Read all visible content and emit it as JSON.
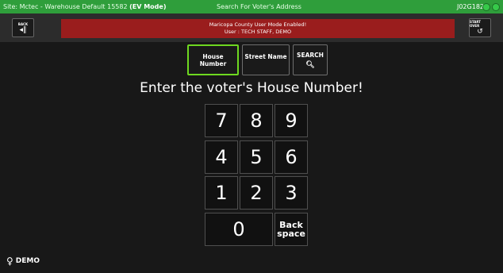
{
  "topbar": {
    "site_prefix": "Site: Mctec - Warehouse Default 15582 ",
    "site_mode": "(EV Mode)",
    "center_title": "Search For Voter's Address",
    "device_id": "J02G182"
  },
  "header": {
    "back_label": "BACK",
    "start_over_label": "START OVER",
    "banner_line1": "Maricopa County User Mode Enabled!",
    "banner_line2": "User : TECH STAFF, DEMO"
  },
  "search_modes": {
    "house_number": "House Number",
    "street_name": "Street Name",
    "search": "SEARCH"
  },
  "prompt": "Enter the voter's House Number!",
  "keypad": {
    "k7": "7",
    "k8": "8",
    "k9": "9",
    "k4": "4",
    "k5": "5",
    "k6": "6",
    "k1": "1",
    "k2": "2",
    "k3": "3",
    "k0": "0",
    "backspace_line1": "Back",
    "backspace_line2": "space"
  },
  "footer": {
    "label": "DEMO"
  },
  "colors": {
    "topbar_green": "#2f9e3b",
    "banner_red": "#9a1d1d",
    "active_border": "#6ed820",
    "background": "#181818"
  }
}
